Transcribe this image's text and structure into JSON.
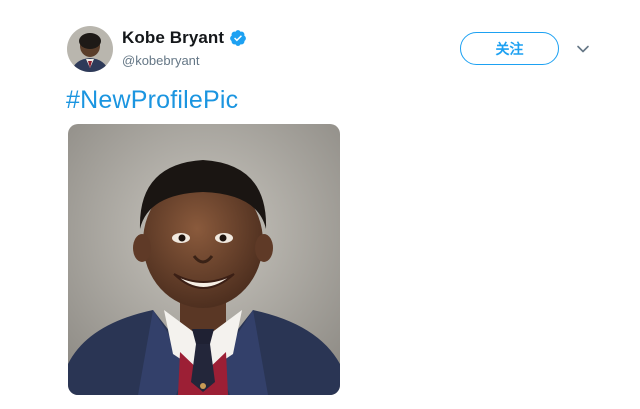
{
  "tweet": {
    "author": {
      "display_name": "Kobe Bryant",
      "handle": "@kobebryant",
      "verified": true,
      "avatar_icon": "avatar-photo-icon"
    },
    "follow_label": "关注",
    "menu_icon": "chevron-down-icon",
    "text": "#NewProfilePic",
    "media": {
      "kind": "photo",
      "description_icon": "school-portrait-photo-icon"
    }
  },
  "colors": {
    "accent": "#1da1f2",
    "hashtag": "#1b95e0",
    "text_primary": "#14171a",
    "text_secondary": "#657786"
  }
}
